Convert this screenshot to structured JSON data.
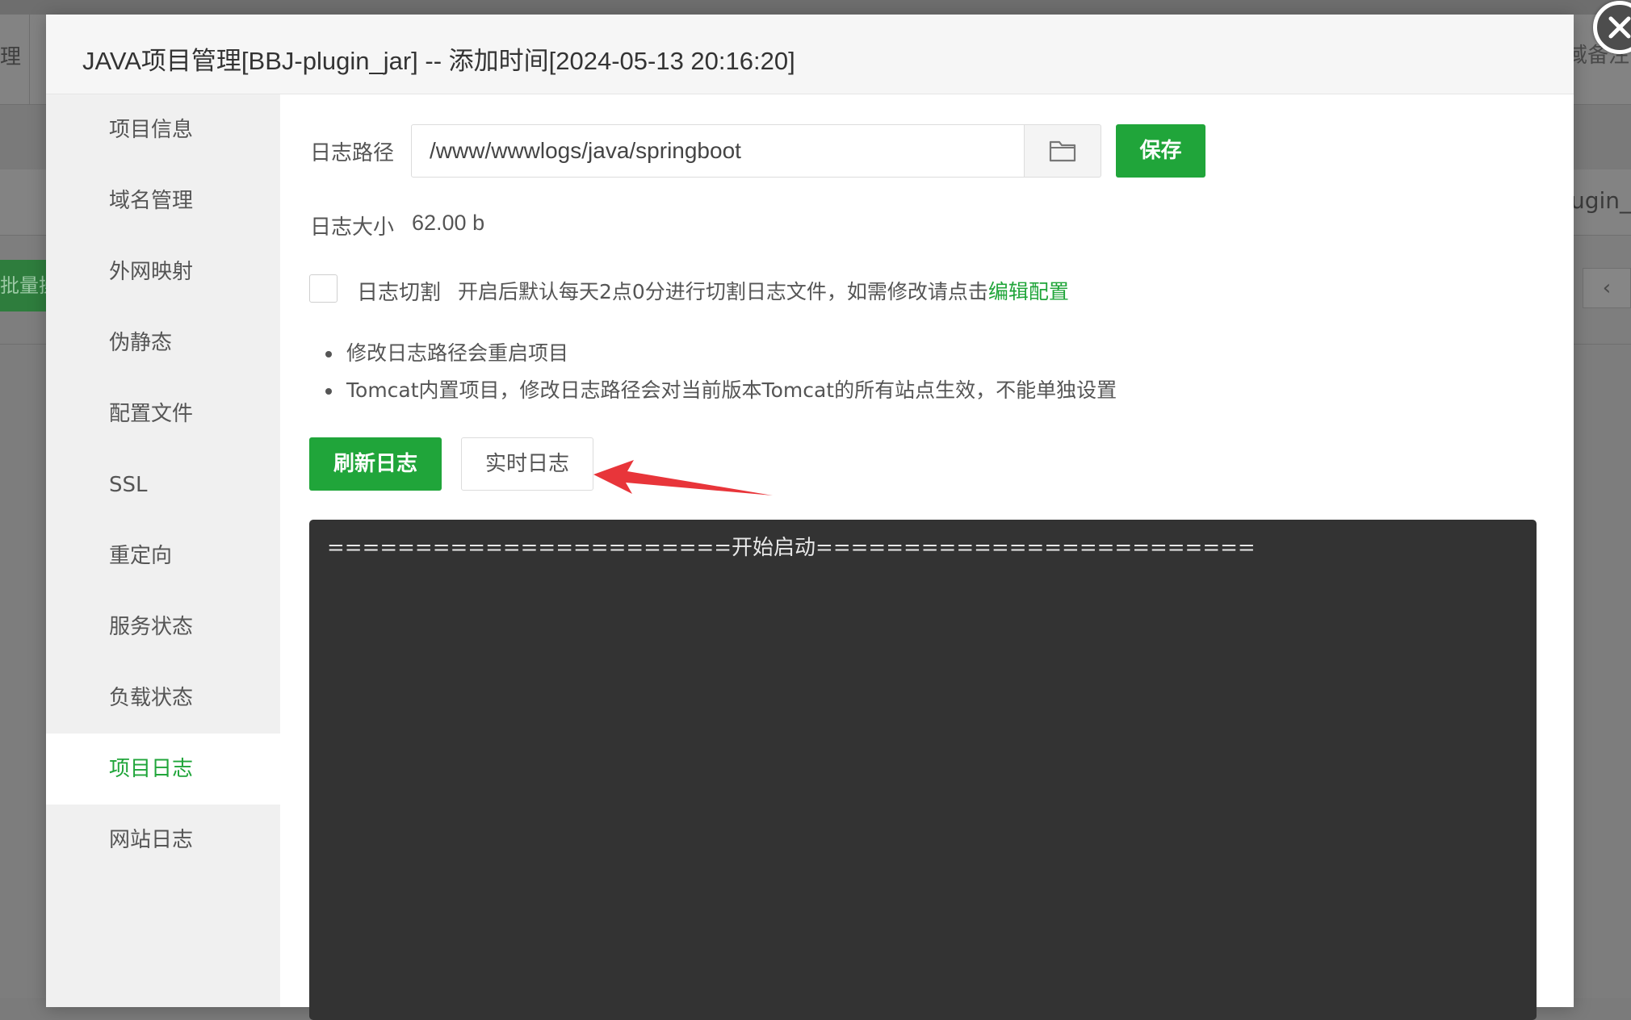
{
  "background": {
    "left_text": "理",
    "right_top_text": "域备注",
    "right_mid_text": "ugin_",
    "batch_button_label": "批量操",
    "pager_prev_icon": "chevron-left-icon"
  },
  "modal": {
    "title": "JAVA项目管理[BBJ-plugin_jar] -- 添加时间[2024-05-13 20:16:20]",
    "close_icon": "close-icon"
  },
  "sidebar": {
    "items": [
      {
        "label": "项目信息",
        "active": false
      },
      {
        "label": "域名管理",
        "active": false
      },
      {
        "label": "外网映射",
        "active": false
      },
      {
        "label": "伪静态",
        "active": false
      },
      {
        "label": "配置文件",
        "active": false
      },
      {
        "label": "SSL",
        "active": false
      },
      {
        "label": "重定向",
        "active": false
      },
      {
        "label": "服务状态",
        "active": false
      },
      {
        "label": "负载状态",
        "active": false
      },
      {
        "label": "项目日志",
        "active": true
      },
      {
        "label": "网站日志",
        "active": false
      }
    ]
  },
  "log_panel": {
    "path_label": "日志路径",
    "path_value": "/www/wwwlogs/java/springboot",
    "folder_icon": "folder-icon",
    "save_label": "保存",
    "size_label": "日志大小",
    "size_value": "62.00 b",
    "rotate_label": "日志切割",
    "rotate_hint": "开启后默认每天2点0分进行切割日志文件，如需修改请点击",
    "rotate_link": "编辑配置",
    "rotate_checked": false,
    "tips": [
      "修改日志路径会重启项目",
      "Tomcat内置项目，修改日志路径会对当前版本Tomcat的所有站点生效，不能单独设置"
    ],
    "refresh_label": "刷新日志",
    "realtime_label": "实时日志",
    "console_text": "=======================开始启动========================="
  },
  "colors": {
    "accent": "#20a53a",
    "console_bg": "#333333",
    "annotation_arrow": "#e8353a"
  }
}
